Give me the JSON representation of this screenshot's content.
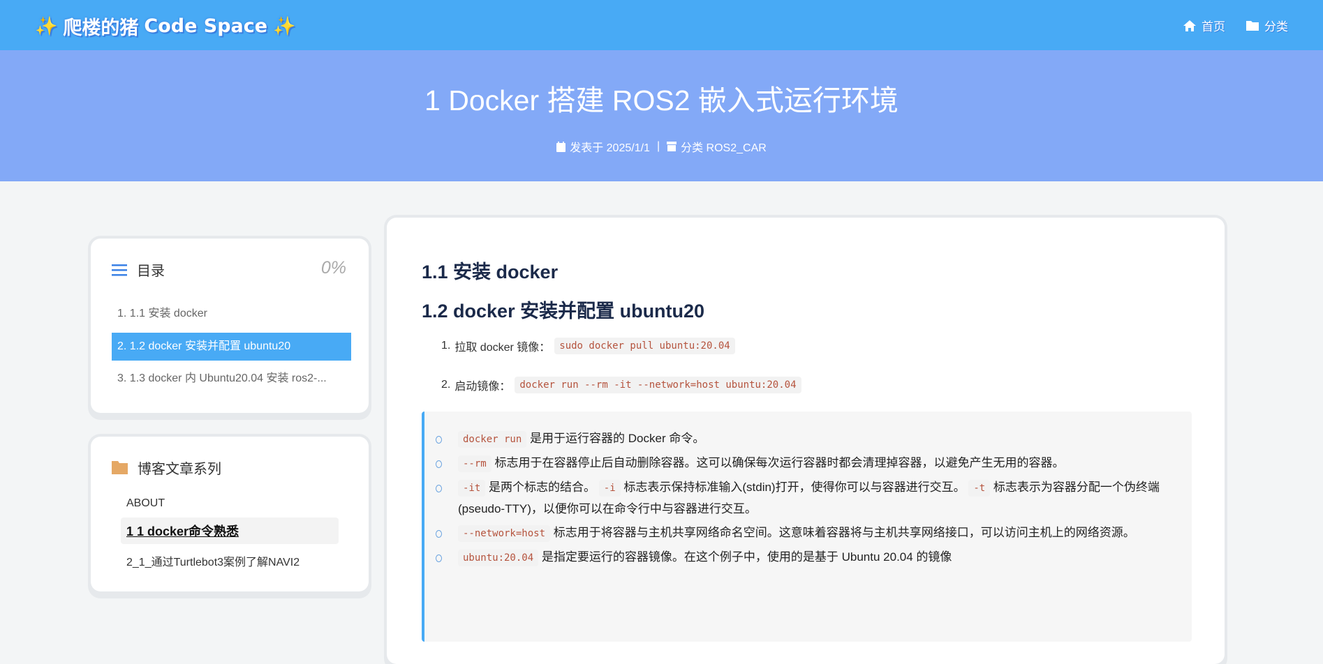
{
  "header": {
    "brand_cn": "爬楼的猪",
    "brand_en": "Code Space",
    "spark": "✨",
    "nav": [
      {
        "icon": "home-icon",
        "label": "首页"
      },
      {
        "icon": "folder-icon",
        "label": "分类"
      }
    ]
  },
  "hero": {
    "title": "1 Docker 搭建 ROS2 嵌入式运行环境",
    "date_label": "发表于 2025/1/1",
    "sep": "|",
    "category_label": "分类 ROS2_CAR"
  },
  "toc": {
    "title": "目录",
    "progress": "0%",
    "items": [
      "1. 1.1 安装 docker",
      "2. 1.2 docker 安装并配置 ubuntu20",
      "3. 1.3 docker 内 Ubuntu20.04 安装 ros2-..."
    ],
    "active_index": 1
  },
  "series": {
    "title": "博客文章系列",
    "items": [
      "ABOUT",
      "1 1 docker命令熟悉",
      "2_1_通过Turtlebot3案例了解NAVI2"
    ]
  },
  "article": {
    "h1": "1.1 安装 docker",
    "h2": "1.2 docker 安装并配置 ubuntu20",
    "steps": [
      {
        "num": "1.",
        "text": "拉取 docker 镜像：",
        "code": "sudo docker pull ubuntu:20.04"
      },
      {
        "num": "2.",
        "text": "启动镜像：",
        "code": "docker run --rm -it --network=host ubuntu:20.04"
      }
    ],
    "bullets": [
      {
        "code": "docker run",
        "text": "是用于运行容器的 Docker 命令。"
      },
      {
        "code": "--rm",
        "text": "标志用于在容器停止后自动删除容器。这可以确保每次运行容器时都会清理掉容器，以避免产生无用的容器。"
      },
      {
        "code": "-it",
        "text": "是两个标志的结合。",
        "code2": "-i",
        "text2": "标志表示保持标准输入(stdin)打开，使得你可以与容器进行交互。",
        "code3": "-t",
        "text3": "标志表示为容器分配一个伪终端(pseudo-TTY)，以便你可以在命令行中与容器进行交互。"
      },
      {
        "code": "--network=host",
        "text": "标志用于将容器与主机共享网络命名空间。这意味着容器将与主机共享网络接口，可以访问主机上的网络资源。"
      },
      {
        "code": "ubuntu:20.04",
        "text": "是指定要运行的容器镜像。在这个例子中，使用的是基于 Ubuntu 20.04 的镜像"
      }
    ]
  }
}
